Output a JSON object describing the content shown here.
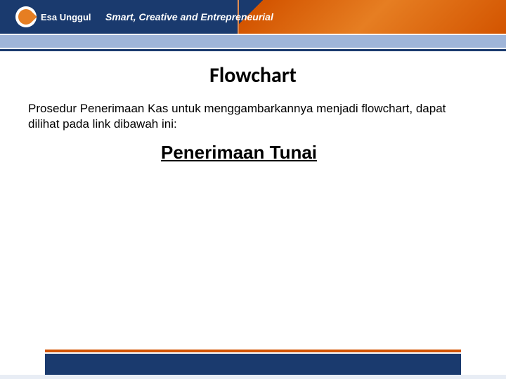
{
  "header": {
    "logo_text": "Esa Unggul",
    "tagline": "Smart, Creative and Entrepreneurial"
  },
  "slide": {
    "title": "Flowchart",
    "body": "Prosedur Penerimaan Kas untuk menggambarkannya menjadi flowchart, dapat dilihat pada link dibawah ini:",
    "link_label": "Penerimaan Tunai"
  }
}
